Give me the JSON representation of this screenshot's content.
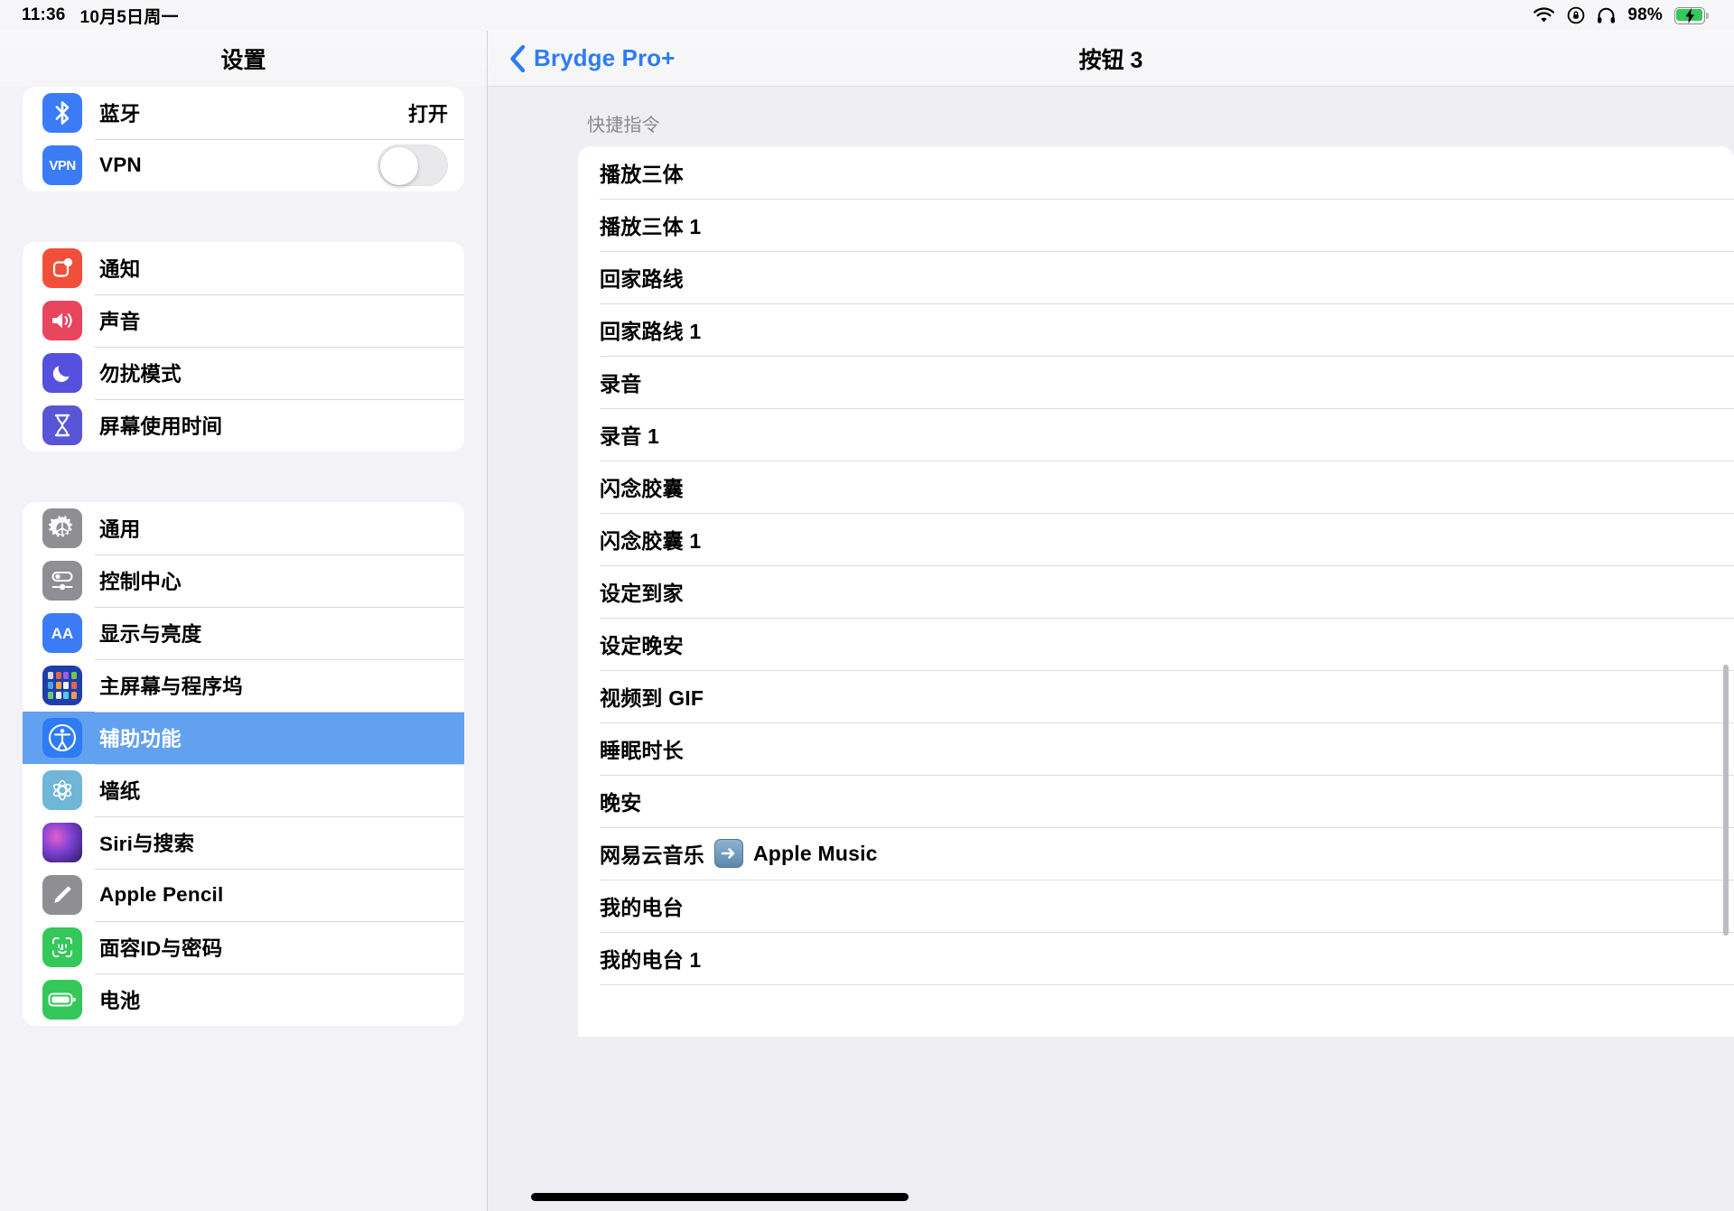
{
  "status_bar": {
    "time": "11:36",
    "date": "10月5日周一",
    "battery_percent": "98%",
    "icons": [
      "wifi-icon",
      "rotation-lock-icon",
      "headphones-icon",
      "battery-charging-icon"
    ],
    "battery_color": "#35c759"
  },
  "sidebar": {
    "title": "设置",
    "selected_item": "辅助功能",
    "selected_color": "#62a0f0",
    "groups": [
      {
        "items": [
          {
            "label": "蓝牙",
            "icon": "bluetooth-icon",
            "value": "打开",
            "control": "value"
          },
          {
            "label": "VPN",
            "icon": "vpn-icon",
            "control": "toggle",
            "toggle_on": false
          }
        ]
      },
      {
        "items": [
          {
            "label": "通知",
            "icon": "notifications-icon",
            "control": "none"
          },
          {
            "label": "声音",
            "icon": "sound-icon",
            "control": "none"
          },
          {
            "label": "勿扰模式",
            "icon": "do-not-disturb-icon",
            "control": "none"
          },
          {
            "label": "屏幕使用时间",
            "icon": "screen-time-icon",
            "control": "none"
          }
        ]
      },
      {
        "items": [
          {
            "label": "通用",
            "icon": "gear-icon",
            "control": "none"
          },
          {
            "label": "控制中心",
            "icon": "control-center-icon",
            "control": "none"
          },
          {
            "label": "显示与亮度",
            "icon": "display-brightness-icon",
            "control": "none"
          },
          {
            "label": "主屏幕与程序坞",
            "icon": "home-screen-dock-icon",
            "control": "none"
          },
          {
            "label": "辅助功能",
            "icon": "accessibility-icon",
            "control": "none",
            "selected": true
          },
          {
            "label": "墙纸",
            "icon": "wallpaper-icon",
            "control": "none"
          },
          {
            "label": "Siri与搜索",
            "icon": "siri-icon",
            "control": "none"
          },
          {
            "label": "Apple Pencil",
            "icon": "apple-pencil-icon",
            "control": "none"
          },
          {
            "label": "面容ID与密码",
            "icon": "face-id-icon",
            "control": "none"
          },
          {
            "label": "电池",
            "icon": "battery-icon",
            "control": "none"
          }
        ]
      }
    ]
  },
  "detail": {
    "back_label": "Brydge Pro+",
    "title": "按钮 3",
    "accent_color": "#2d7cf6",
    "section_header": "快捷指令",
    "shortcuts": [
      {
        "label": "播放三体"
      },
      {
        "label": "播放三体 1"
      },
      {
        "label": "回家路线"
      },
      {
        "label": "回家路线 1"
      },
      {
        "label": "录音"
      },
      {
        "label": "录音 1"
      },
      {
        "label": "闪念胶囊"
      },
      {
        "label": "闪念胶囊 1"
      },
      {
        "label": "设定到家"
      },
      {
        "label": "设定晚安"
      },
      {
        "label": "视频到 GIF"
      },
      {
        "label": "睡眠时长"
      },
      {
        "label": "晚安"
      },
      {
        "label_prefix": "网易云音乐",
        "emoji": "right-arrow-emoji",
        "label_suffix": "Apple Music"
      },
      {
        "label": "我的电台"
      },
      {
        "label": "我的电台 1"
      }
    ]
  }
}
